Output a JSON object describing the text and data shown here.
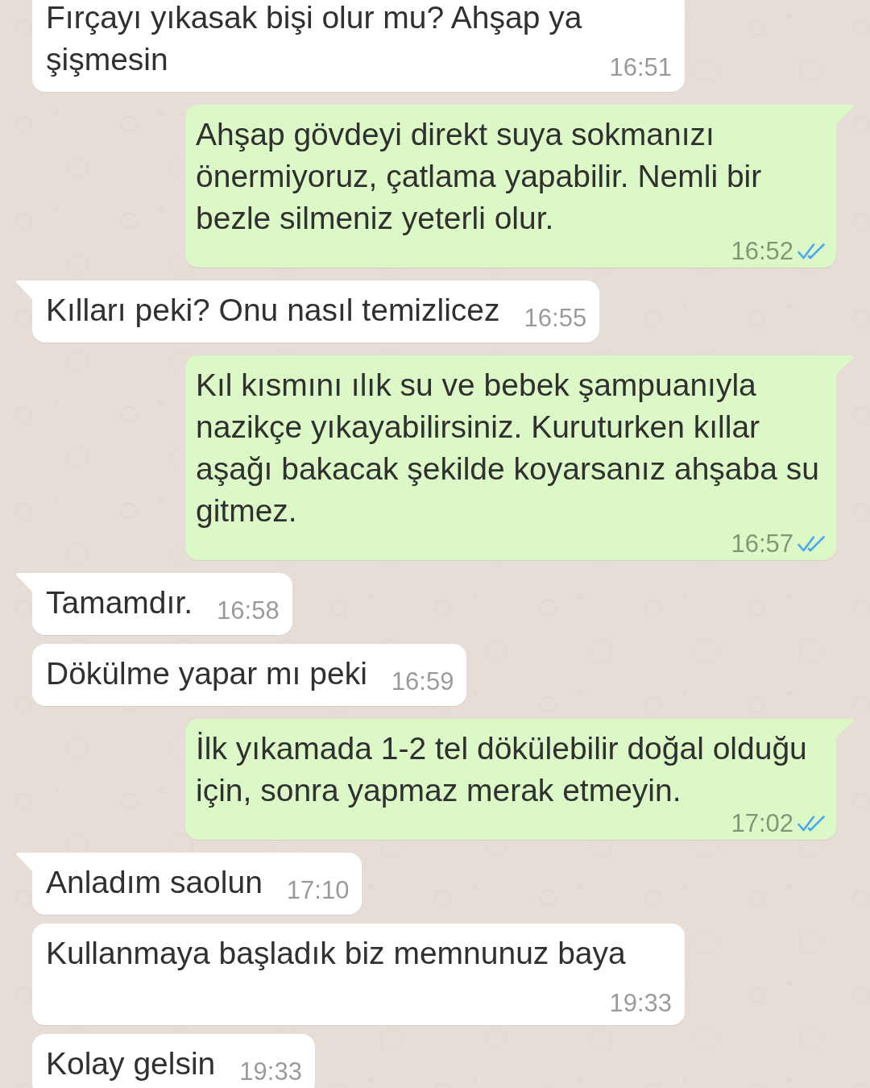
{
  "messages": [
    {
      "kind": "incoming",
      "tail": false,
      "text": "Fırçayı yıkasak bişi olur mu? Ahşap ya şişmesin",
      "time": "16:51"
    },
    {
      "kind": "outgoing",
      "tail": true,
      "text": "Ahşap gövdeyi direkt suya sokmanızı önermiyoruz, çatlama yapabilir. Nemli bir bezle silmeniz yeterli olur.",
      "time": "16:52",
      "read": true
    },
    {
      "kind": "incoming",
      "tail": true,
      "text": "Kılları peki? Onu nasıl temizlicez",
      "time": "16:55"
    },
    {
      "kind": "outgoing",
      "tail": true,
      "text": "Kıl kısmını ılık su ve bebek şampuanıyla nazikçe yıkayabilirsiniz. Kuruturken kıllar aşağı bakacak şekilde koyarsanız ahşaba su gitmez.",
      "time": "16:57",
      "read": true
    },
    {
      "kind": "incoming",
      "tail": true,
      "text": "Tamamdır.",
      "time": "16:58"
    },
    {
      "kind": "incoming",
      "tail": false,
      "text": "Dökülme yapar mı peki",
      "time": "16:59"
    },
    {
      "kind": "outgoing",
      "tail": true,
      "text": "İlk yıkamada 1-2 tel dökülebilir doğal olduğu için, sonra yapmaz merak etmeyin.",
      "time": "17:02",
      "read": true
    },
    {
      "kind": "incoming",
      "tail": true,
      "text": "Anladım saolun",
      "time": "17:10"
    },
    {
      "kind": "incoming",
      "tail": false,
      "text": "Kullanmaya başladık biz memnunuz baya",
      "time": "19:33"
    },
    {
      "kind": "incoming",
      "tail": false,
      "text": "Kolay gelsin",
      "time": "19:33"
    }
  ]
}
